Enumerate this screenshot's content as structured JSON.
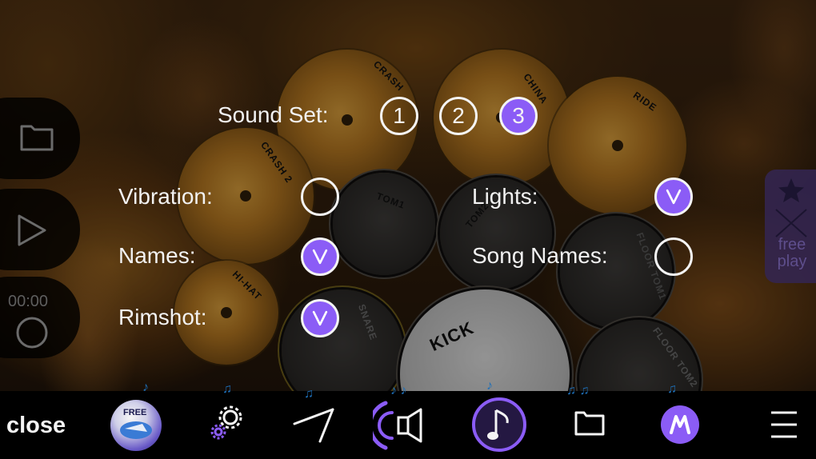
{
  "settings": {
    "sound_set_label": "Sound Set:",
    "sound_sets": [
      {
        "label": "1",
        "selected": false
      },
      {
        "label": "2",
        "selected": false
      },
      {
        "label": "3",
        "selected": true
      }
    ],
    "vibration_label": "Vibration:",
    "vibration_on": false,
    "lights_label": "Lights:",
    "lights_on": true,
    "names_label": "Names:",
    "names_on": true,
    "song_names_label": "Song Names:",
    "song_names_on": false,
    "rimshot_label": "Rimshot:",
    "rimshot_on": true
  },
  "drum_kit": {
    "labels": {
      "crash": "CRASH",
      "china": "CHINA",
      "ride": "RIDE",
      "crash2": "CRASH 2",
      "tom1": "TOM1",
      "tom2": "TOM2",
      "floor_tom1": "FLOOR TOM1",
      "hihat": "HI-HAT",
      "snare": "SNARE",
      "kick": "KICK",
      "floor_tom2": "FLOOR TOM2"
    }
  },
  "left_rail": {
    "timer": "00:00",
    "icons": [
      "folder-icon",
      "play-icon",
      "record-icon"
    ]
  },
  "freeplay": {
    "text_line1": "free",
    "text_line2": "play",
    "icons": [
      "star-icon",
      "crossed-sticks-icon"
    ]
  },
  "toolbar": {
    "close_label": "close",
    "badge_text": "FREE",
    "icons": [
      "free-songs-icon",
      "settings-gear-icon",
      "drumsticks-icon",
      "sound-speaker-icon",
      "music-note-icon",
      "folder-icon",
      "app-logo-icon",
      "menu-icon"
    ]
  },
  "colors": {
    "accent": "#8b5cf6",
    "note_blue": "#1e6fb8",
    "toolbar_bg": "#000000"
  }
}
